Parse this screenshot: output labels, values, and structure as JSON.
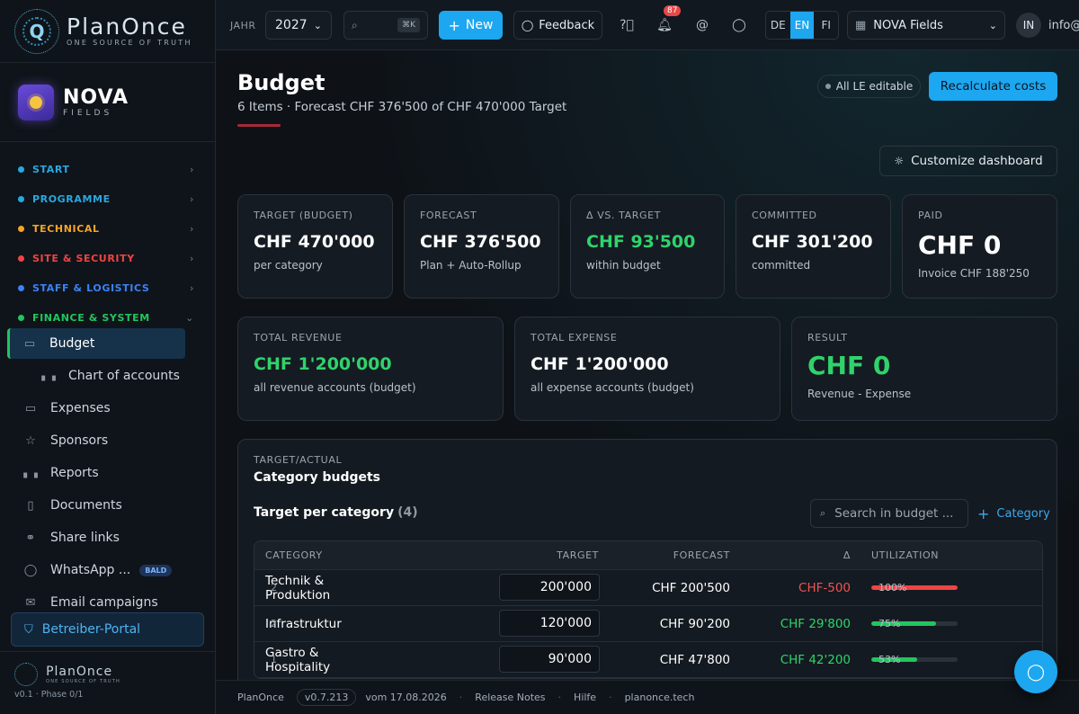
{
  "brand": {
    "name": "PlanOnce",
    "tagline": "ONE SOURCE OF TRUTH"
  },
  "project": {
    "name": "NOVA",
    "sub": "FIELDS"
  },
  "nav": {
    "sections": [
      {
        "label": "START",
        "color": "#29a8e0"
      },
      {
        "label": "PROGRAMME",
        "color": "#29a8e0"
      },
      {
        "label": "TECHNICAL",
        "color": "#f5a524"
      },
      {
        "label": "SITE & SECURITY",
        "color": "#ef4444"
      },
      {
        "label": "STAFF & LOGISTICS",
        "color": "#3b82f6"
      },
      {
        "label": "FINANCE & SYSTEM",
        "color": "#22c55e"
      }
    ],
    "items": [
      {
        "label": "Budget"
      },
      {
        "label": "Chart of accounts"
      },
      {
        "label": "Expenses"
      },
      {
        "label": "Sponsors"
      },
      {
        "label": "Reports"
      },
      {
        "label": "Documents"
      },
      {
        "label": "Share links"
      },
      {
        "label": "WhatsApp ...",
        "badge": "BALD"
      },
      {
        "label": "Email campaigns"
      }
    ],
    "portal": "Betreiber-Portal"
  },
  "sidebar_footer": {
    "name": "PlanOnce",
    "tagline": "ONE SOURCE OF TRUTH",
    "version": "v0.1 · Phase 0/1"
  },
  "topbar": {
    "year_label": "JAHR",
    "year": "2027",
    "search_shortcut": "⌘K",
    "new_label": "New",
    "feedback_label": "Feedback",
    "notifications": "87",
    "langs": [
      "DE",
      "EN",
      "FI"
    ],
    "active_lang": "EN",
    "workspace": "NOVA Fields",
    "avatar": "IN",
    "user": "info@"
  },
  "page": {
    "title": "Budget",
    "subtitle": "6 Items · Forecast CHF 376'500 of CHF 470'000 Target",
    "editable_chip": "All LE editable",
    "recalc_label": "Recalculate costs",
    "customize_label": "Customize dashboard"
  },
  "kpis": [
    {
      "label": "TARGET (BUDGET)",
      "value": "CHF 470'000",
      "sub": "per category"
    },
    {
      "label": "FORECAST",
      "value": "CHF 376'500",
      "sub": "Plan + Auto-Rollup"
    },
    {
      "label": "Δ VS. TARGET",
      "value": "CHF 93'500",
      "sub": "within budget"
    },
    {
      "label": "COMMITTED",
      "value": "CHF 301'200",
      "sub": "committed"
    },
    {
      "label": "PAID",
      "value": "CHF 0",
      "sub": "Invoice CHF 188'250"
    }
  ],
  "totals": [
    {
      "label": "TOTAL REVENUE",
      "value": "CHF 1'200'000",
      "sub": "all revenue accounts (budget)"
    },
    {
      "label": "TOTAL EXPENSE",
      "value": "CHF 1'200'000",
      "sub": "all expense accounts (budget)"
    },
    {
      "label": "RESULT",
      "value": "CHF 0",
      "sub": "Revenue - Expense"
    }
  ],
  "budget_table": {
    "section_label": "TARGET/ACTUAL",
    "title": "Category budgets",
    "subtitle": "Target per category",
    "count": "(4)",
    "search_placeholder": "Search in budget ...",
    "add_label": "Category",
    "columns": [
      "CATEGORY",
      "TARGET",
      "FORECAST",
      "Δ",
      "UTILIZATION"
    ],
    "rows": [
      {
        "category": "Technik & Produktion",
        "n": "2",
        "target": "200'000",
        "forecast": "CHF 200'500",
        "delta": "CHF-500",
        "utilization": 100,
        "util_label": "100%",
        "status_color": "#ef4444"
      },
      {
        "category": "Infrastruktur",
        "n": "2",
        "target": "120'000",
        "forecast": "CHF 90'200",
        "delta": "CHF 29'800",
        "utilization": 75,
        "util_label": "75%",
        "status_color": "#22c55e"
      },
      {
        "category": "Gastro & Hospitality",
        "n": "1",
        "target": "90'000",
        "forecast": "CHF 47'800",
        "delta": "CHF 42'200",
        "utilization": 53,
        "util_label": "53%",
        "status_color": "#22c55e"
      }
    ]
  },
  "footer": {
    "app": "PlanOnce",
    "version": "v0.7.213",
    "date": "vom 17.08.2026",
    "links": [
      "Release Notes",
      "Hilfe",
      "planonce.tech"
    ]
  }
}
